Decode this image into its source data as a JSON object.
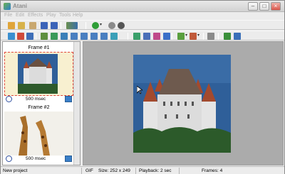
{
  "app": {
    "title": "Atani"
  },
  "menu": [
    "File",
    "Edit",
    "Effects",
    "Play",
    "Tools",
    "Help"
  ],
  "frames": [
    {
      "label": "Frame #1",
      "duration": "500 msec",
      "selected": true,
      "image": "castle-thumbnail"
    },
    {
      "label": "Frame #2",
      "duration": "500 msec",
      "selected": false,
      "image": "giraffes-thumbnail"
    }
  ],
  "preview": {
    "image": "castle-preview"
  },
  "status": {
    "message": "New project",
    "format": "GIF",
    "size": "Size: 252 x 249",
    "playback": "Playback: 2 sec",
    "frames": "Frames: 4"
  },
  "colors": {
    "selection": "#e0463c",
    "play": "#2e9e37",
    "stop": "#d23a2a",
    "sky": "#2f5f99",
    "canvas": "#ababab"
  }
}
